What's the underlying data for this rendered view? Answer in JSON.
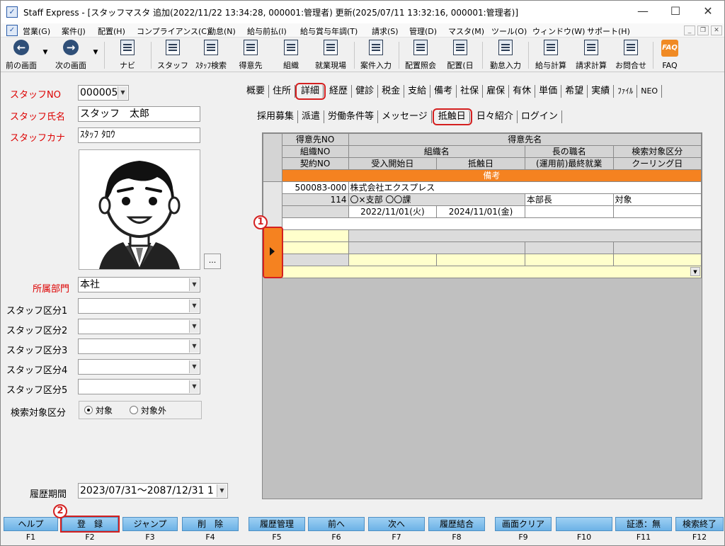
{
  "window": {
    "title": "Staff Express - [スタッフマスタ 追加(2022/11/22 13:34:28, 000001:管理者) 更新(2025/07/11 13:32:16, 000001:管理者)]",
    "controls": [
      "—",
      "☐",
      "✕"
    ]
  },
  "menu": [
    "営業(G)",
    "案件(J)",
    "配置(H)",
    "コンプライアンス(C)",
    "勤怠(N)",
    "給与前払(I)",
    "給与賞与年調(T)",
    "請求(S)",
    "管理(D)",
    "マスタ(M)",
    "ツール(O)",
    "ウィンドウ(W)",
    "サポート(H)"
  ],
  "toolbar": {
    "prev": "前の画面",
    "next": "次の画面",
    "navi": "ナビ",
    "staff": "スタッフ",
    "staff_search": "ｽﾀｯﾌ検索",
    "client": "得意先",
    "org": "組織",
    "worksite": "就業現場",
    "job_input": "案件入力",
    "assign_inquiry": "配置照会",
    "assign": "配置(日",
    "attendance": "勤怠入力",
    "salary_calc": "給与計算",
    "billing_calc": "請求計算",
    "inquiry": "お問合せ",
    "faq": "FAQ"
  },
  "form": {
    "staff_no_label": "スタッフNO",
    "staff_no": "000005",
    "staff_name_label": "スタッフ氏名",
    "staff_name": "スタッフ　太郎",
    "staff_kana_label": "スタッフカナ",
    "staff_kana": "ｽﾀｯﾌ ﾀﾛｳ",
    "photo_button": "...",
    "dept_label": "所属部門",
    "dept": "本社",
    "cat1_label": "スタッフ区分1",
    "cat2_label": "スタッフ区分2",
    "cat3_label": "スタッフ区分3",
    "cat4_label": "スタッフ区分4",
    "cat5_label": "スタッフ区分5",
    "search_label": "検索対象区分",
    "search_on": "対象",
    "search_off": "対象外",
    "period_label": "履歴期間",
    "period": "2023/07/31～2087/12/31 1"
  },
  "tabs_main": [
    "概要",
    "住所",
    "詳細",
    "経歴",
    "健診",
    "税金",
    "支給",
    "備考",
    "社保",
    "雇保",
    "有休",
    "単価",
    "希望",
    "実績",
    "ﾌｧｲﾙ",
    "NEO"
  ],
  "tabs_sub": [
    "採用募集",
    "派遣",
    "労働条件等",
    "メッセージ",
    "抵触日",
    "日々紹介",
    "ログイン"
  ],
  "grid": {
    "h_client_no": "得意先NO",
    "h_client_name": "得意先名",
    "h_org_no": "組織NO",
    "h_org_name": "組織名",
    "h_head_title": "長の職名",
    "h_search": "検索対象区分",
    "h_contract_no": "契約NO",
    "h_accept_start": "受入開始日",
    "h_conflict_date": "抵触日",
    "h_last_work": "(運用前)最終就業",
    "h_cooling": "クーリング日",
    "h_remarks": "備考",
    "r_client_no": "500083-000",
    "r_client_name": "株式会社エクスプレス",
    "r_org_no": "114",
    "r_org_name": "〇×支部 〇〇課",
    "r_head_title": "本部長",
    "r_search": "対象",
    "r_accept_start": "2022/11/01(火)",
    "r_conflict_date": "2024/11/01(金)"
  },
  "markers": {
    "m1": "1",
    "m2": "2"
  },
  "fkeys": [
    {
      "label": "ヘルプ",
      "key": "F1"
    },
    {
      "label": "登　録",
      "key": "F2"
    },
    {
      "label": "ジャンプ",
      "key": "F3"
    },
    {
      "label": "削　除",
      "key": "F4"
    },
    {
      "label": "履歴管理",
      "key": "F5"
    },
    {
      "label": "前へ",
      "key": "F6"
    },
    {
      "label": "次へ",
      "key": "F7"
    },
    {
      "label": "履歴結合",
      "key": "F8"
    },
    {
      "label": "画面クリア",
      "key": "F9"
    },
    {
      "label": "",
      "key": "F10"
    },
    {
      "label": "証憑：無",
      "key": "F11"
    },
    {
      "label": "検索終了",
      "key": "F12"
    }
  ],
  "colors": {
    "accent_orange": "#f58220",
    "highlight_red": "#d42020",
    "fkey_blue": "#7dbde9",
    "label_red": "#dd0000"
  }
}
